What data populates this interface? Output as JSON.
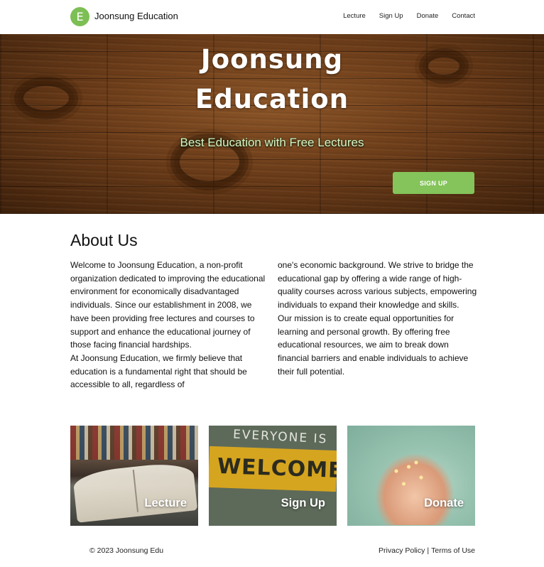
{
  "nav": {
    "logo_letter": "E",
    "brand": "Joonsung Education",
    "links": [
      {
        "label": "Lecture"
      },
      {
        "label": "Sign Up"
      },
      {
        "label": "Donate"
      },
      {
        "label": "Contact"
      }
    ]
  },
  "hero": {
    "title_line1": "Joonsung",
    "title_line2": "Education",
    "subtitle": "Best Education with Free Lectures",
    "button_label": "SIGN UP"
  },
  "about": {
    "title": "About Us",
    "left_paragraphs": [
      "Welcome to Joonsung Education, a non-profit organization dedicated to improving the educational environment for economically disadvantaged individuals. Since our establishment in 2008, we have been providing free lectures and courses to support and enhance the educational journey of those facing financial hardships.",
      "At Joonsung Education, we firmly believe that education is a fundamental right that should be accessible to all, regardless of"
    ],
    "right_paragraphs": [
      "one's economic background. We strive to bridge the educational gap by offering a wide range of high-quality courses across various subjects, empowering individuals to expand their knowledge and skills.",
      "Our mission is to create equal opportunities for learning and personal growth. By offering free educational resources, we aim to break down financial barriers and enable individuals to achieve their full potential."
    ]
  },
  "cards": [
    {
      "label": "Lecture",
      "image": "open-books-photo"
    },
    {
      "label": "Sign Up",
      "image": "welcome-sign-photo",
      "sign_top": "EVERYONE IS",
      "sign_main": "WELCOME"
    },
    {
      "label": "Donate",
      "image": "hands-holding-lights-photo"
    }
  ],
  "footer": {
    "copyright": "© 2023 Joonsung Edu",
    "privacy": "Privacy Policy",
    "separator": "|",
    "terms": "Terms of Use"
  },
  "colors": {
    "accent": "#84c45a",
    "logo": "#7dbf55",
    "hero_subtitle": "#d9f5c6"
  }
}
